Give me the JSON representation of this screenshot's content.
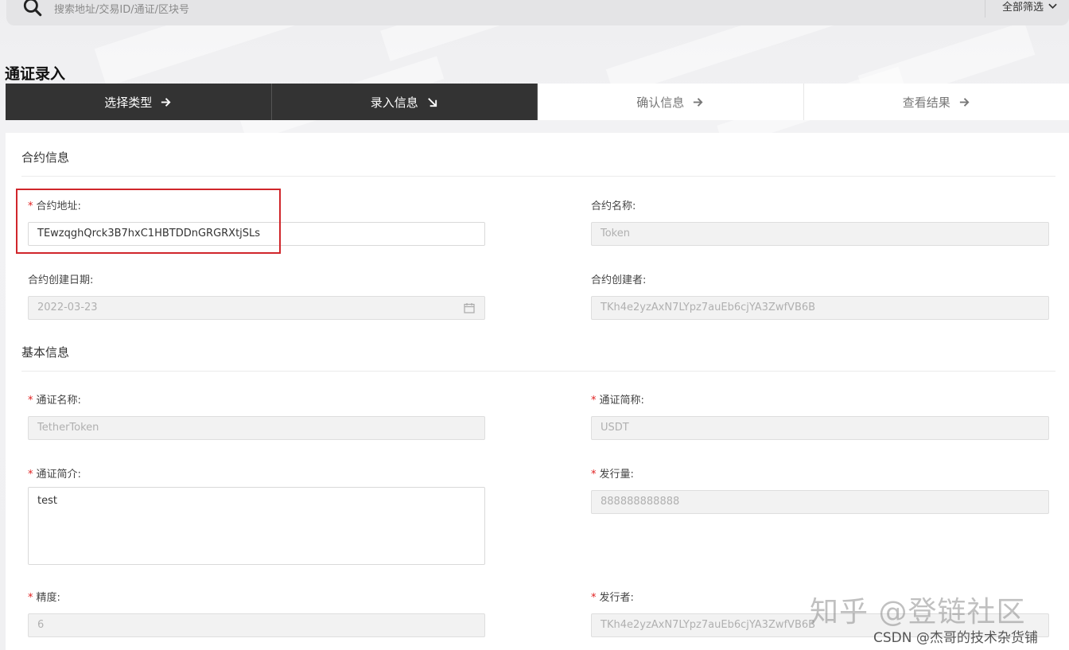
{
  "search": {
    "placeholder": "搜索地址/交易ID/通证/区块号",
    "filter_label": "全部筛选"
  },
  "page": {
    "title": "通证录入"
  },
  "steps": [
    {
      "label": "选择类型",
      "active": true
    },
    {
      "label": "录入信息",
      "active": true
    },
    {
      "label": "确认信息",
      "active": false
    },
    {
      "label": "查看结果",
      "active": false
    }
  ],
  "contract_section": {
    "title": "合约信息",
    "contract_address": {
      "label": "合约地址:",
      "required": true,
      "value": "TEwzqghQrck3B7hxC1HBTDDnGRGRXtjSLs"
    },
    "contract_name": {
      "label": "合约名称:",
      "value": "Token"
    },
    "create_date": {
      "label": "合约创建日期:",
      "value": "2022-03-23"
    },
    "creator": {
      "label": "合约创建者:",
      "value": "TKh4e2yzAxN7LYpz7auEb6cjYA3ZwfVB6B"
    }
  },
  "basic_section": {
    "title": "基本信息",
    "token_name": {
      "label": "通证名称:",
      "required": true,
      "value": "TetherToken"
    },
    "token_symbol": {
      "label": "通证简称:",
      "required": true,
      "value": "USDT"
    },
    "token_intro": {
      "label": "通证简介:",
      "required": true,
      "value": "test"
    },
    "total_supply": {
      "label": "发行量:",
      "required": true,
      "value": "888888888888"
    },
    "precision": {
      "label": "精度:",
      "required": true,
      "value": "6"
    },
    "issuer": {
      "label": "发行者:",
      "required": true,
      "value": "TKh4e2yzAxN7LYpz7auEb6cjYA3ZwfVB6B"
    }
  },
  "required_mark": "*",
  "watermarks": {
    "zhihu": "知乎 @登链社区",
    "csdn": "CSDN @杰哥的技术杂货铺"
  },
  "colors": {
    "step_active": "#333333",
    "required": "#e02020",
    "highlight": "#d0262b"
  }
}
